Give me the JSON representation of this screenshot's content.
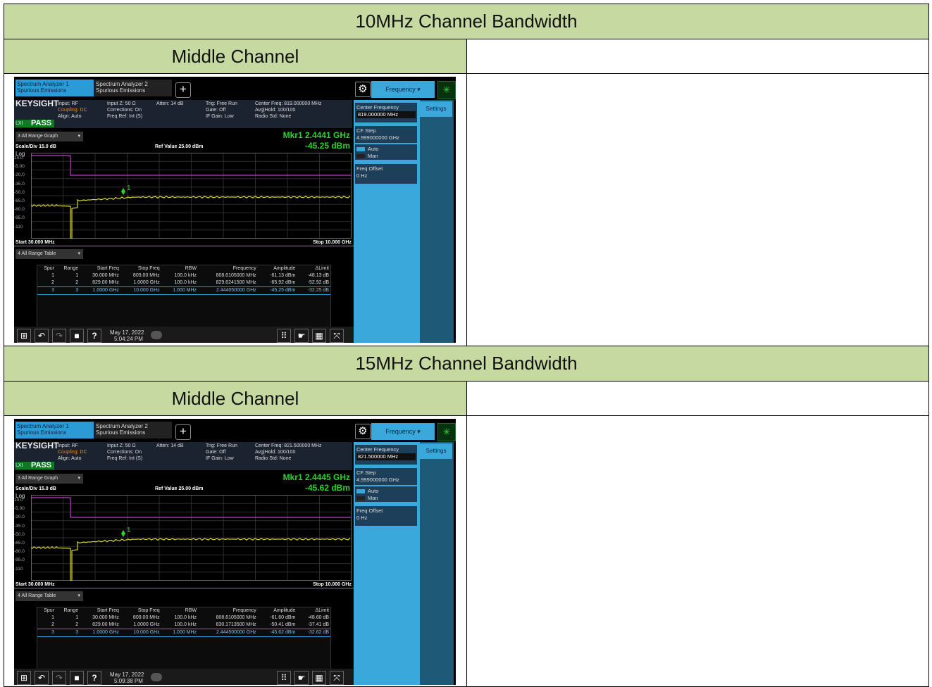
{
  "sections": [
    {
      "bandwidth_title": "10MHz Channel Bandwidth",
      "channel_label": "Middle Channel",
      "screen": {
        "tab1_line1": "Spectrum Analyzer 1",
        "tab1_line2": "Spurious Emissions",
        "tab2_line1": "Spectrum Analyzer 2",
        "tab2_line2": "Spurious Emissions",
        "top_menu": "Frequency",
        "brand": "KEYSIGHT",
        "input": "Input: RF",
        "coupling": "Coupling: DC",
        "align": "Align: Auto",
        "input_z": "Input Z: 50 Ω",
        "corrections": "Corrections: On",
        "freq_ref": "Freq Ref: Int (S)",
        "atten": "Atten: 14 dB",
        "trig": "Trig: Free Run",
        "gate": "Gate: Off",
        "if_gain": "IF Gain: Low",
        "center_freq_info": "Center Freq: 819.000000 MHz",
        "avg_hold": "Avg|Hold: 100/100",
        "radio_std": "Radio Std: None",
        "pass_label": "PASS",
        "lxi": "LXI",
        "graph_selector": "3 All Range Graph",
        "marker_freq": "Mkr1  2.4441 GHz",
        "marker_amp": "-45.25 dBm",
        "scale_div": "Scale/Div 15.0 dB",
        "log": "Log",
        "ref_value": "Ref Value 25.00 dBm",
        "y_ticks": [
          "10.0",
          "-5.00",
          "-20.0",
          "-35.0",
          "-50.0",
          "-65.0",
          "-80.0",
          "-95.0",
          "-110"
        ],
        "marker_label": "1",
        "start": "Start 30.000 MHz",
        "stop": "Stop 10.000 GHz",
        "table_selector": "4 All Range Table",
        "table_headers": [
          "Spur",
          "Range",
          "Start Freq",
          "Stop Freq",
          "RBW",
          "Frequency",
          "Amplitude",
          "ΔLimit"
        ],
        "table_rows": [
          [
            "1",
            "1",
            "30.000 MHz",
            "809.00 MHz",
            "100.0 kHz",
            "808.6105000 MHz",
            "-61.13 dBm",
            "-48.13 dB"
          ],
          [
            "2",
            "2",
            "829.00 MHz",
            "1.0000 GHz",
            "100.0 kHz",
            "829.6241500 MHz",
            "-65.92 dBm",
            "-52.92 dB"
          ],
          [
            "3",
            "3",
            "1.0000 GHz",
            "10.000 GHz",
            "1.000 MHz",
            "2.444050000 GHz",
            "-45.25 dBm",
            "-32.25 dB"
          ]
        ],
        "date": "May 17, 2022",
        "time": "5:04:24 PM",
        "settings_tab": "Settings",
        "center_frequency_label": "Center Frequency",
        "center_frequency_value": "819.000000 MHz",
        "cf_step_label": "CF Step",
        "cf_step_value": "4.999000000 GHz",
        "auto": "Auto",
        "man": "Man",
        "freq_offset_label": "Freq Offset",
        "freq_offset_value": "0 Hz",
        "trace_color": "#d8d82a",
        "limit_color": "#c43ad0",
        "marker_color": "#28d628"
      }
    },
    {
      "bandwidth_title": "15MHz Channel Bandwidth",
      "channel_label": "Middle Channel",
      "screen": {
        "tab1_line1": "Spectrum Analyzer 1",
        "tab1_line2": "Spurious Emissions",
        "tab2_line1": "Spectrum Analyzer 2",
        "tab2_line2": "Spurious Emissions",
        "top_menu": "Frequency",
        "brand": "KEYSIGHT",
        "input": "Input: RF",
        "coupling": "Coupling: DC",
        "align": "Align: Auto",
        "input_z": "Input Z: 50 Ω",
        "corrections": "Corrections: On",
        "freq_ref": "Freq Ref: Int (S)",
        "atten": "Atten: 14 dB",
        "trig": "Trig: Free Run",
        "gate": "Gate: Off",
        "if_gain": "IF Gain: Low",
        "center_freq_info": "Center Freq: 821.500000 MHz",
        "avg_hold": "Avg|Hold: 100/100",
        "radio_std": "Radio Std: None",
        "pass_label": "PASS",
        "lxi": "LXI",
        "graph_selector": "3 All Range Graph",
        "marker_freq": "Mkr1  2.4445 GHz",
        "marker_amp": "-45.62 dBm",
        "scale_div": "Scale/Div 15.0 dB",
        "log": "Log",
        "ref_value": "Ref Value 25.00 dBm",
        "y_ticks": [
          "10.0",
          "-5.00",
          "-20.0",
          "-35.0",
          "-50.0",
          "-65.0",
          "-80.0",
          "-95.0",
          "-110"
        ],
        "marker_label": "1",
        "start": "Start 30.000 MHz",
        "stop": "Stop 10.000 GHz",
        "table_selector": "4 All Range Table",
        "table_headers": [
          "Spur",
          "Range",
          "Start Freq",
          "Stop Freq",
          "RBW",
          "Frequency",
          "Amplitude",
          "ΔLimit"
        ],
        "table_rows": [
          [
            "1",
            "1",
            "30.000 MHz",
            "809.00 MHz",
            "100.0 kHz",
            "808.6105000 MHz",
            "-61.60 dBm",
            "-48.60 dB"
          ],
          [
            "2",
            "2",
            "829.00 MHz",
            "1.0000 GHz",
            "100.0 kHz",
            "830.1713500 MHz",
            "-50.41 dBm",
            "-37.41 dB"
          ],
          [
            "3",
            "3",
            "1.0000 GHz",
            "10.000 GHz",
            "1.000 MHz",
            "2.444500000 GHz",
            "-45.62 dBm",
            "-32.62 dB"
          ]
        ],
        "date": "May 17, 2022",
        "time": "5:09:38 PM",
        "settings_tab": "Settings",
        "center_frequency_label": "Center Frequency",
        "center_frequency_value": "821.500000 MHz",
        "cf_step_label": "CF Step",
        "cf_step_value": "4.999000000 GHz",
        "auto": "Auto",
        "man": "Man",
        "freq_offset_label": "Freq Offset",
        "freq_offset_value": "0 Hz",
        "trace_color": "#d8d82a",
        "limit_color": "#c43ad0",
        "marker_color": "#28d628"
      }
    }
  ]
}
